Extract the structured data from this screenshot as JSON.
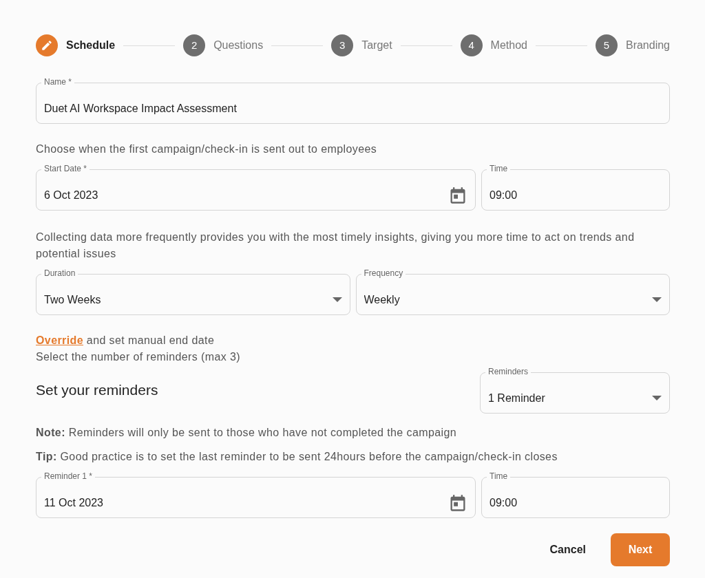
{
  "steps": [
    {
      "label": "Schedule",
      "selected": true
    },
    {
      "number": "2",
      "label": "Questions",
      "selected": false
    },
    {
      "number": "3",
      "label": "Target",
      "selected": false
    },
    {
      "number": "4",
      "label": "Method",
      "selected": false
    },
    {
      "number": "5",
      "label": "Branding",
      "selected": false
    }
  ],
  "name_field": {
    "label": "Name *",
    "value": "Duet AI Workspace Impact Assessment"
  },
  "start_note": "Choose when the first campaign/check-in is sent out to employees",
  "start_row": [
    {
      "kind": "date",
      "label": "Start Date *",
      "value": "6 Oct 2023"
    },
    {
      "kind": "time",
      "label": "Time",
      "value": "09:00"
    }
  ],
  "frequency_note": "Collecting data more frequently provides you with the most timely insights, giving you more time to act on trends and potential issues",
  "frequency_row": [
    {
      "kind": "select",
      "label": "Duration",
      "value": "Two Weeks"
    },
    {
      "kind": "select",
      "label": "Frequency",
      "value": "Weekly"
    }
  ],
  "override": {
    "link": "Override",
    "text": "and set manual end date"
  },
  "reminders_hint": "Select the number of reminders (max 3)",
  "reminders_title": "Set your reminders",
  "reminders_select": {
    "kind": "select",
    "label": "Reminders",
    "value": "1 Reminder"
  },
  "note": "**Note:** Reminders will only be sent to those who have not completed the campaign",
  "tip": "**Tip:** Good practice is to set the last reminder to be sent 24hours before the campaign/check-in closes",
  "reminder_row": [
    {
      "kind": "date",
      "label": "Reminder 1 *",
      "value": "11 Oct 2023"
    },
    {
      "kind": "time",
      "label": "Time",
      "value": "09:00"
    }
  ],
  "buttons": [
    {
      "kind": "text",
      "label": "Cancel"
    },
    {
      "kind": "primary",
      "label": "Next"
    }
  ]
}
